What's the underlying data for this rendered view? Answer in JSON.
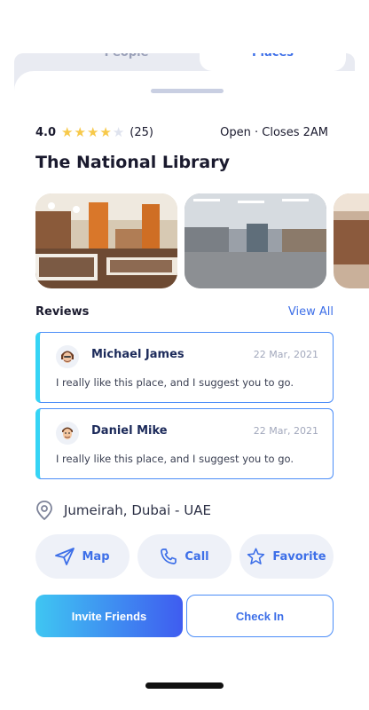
{
  "segment": {
    "tabs": [
      {
        "label": "People"
      },
      {
        "label": "Places"
      }
    ],
    "active": "Places"
  },
  "place": {
    "rating": "4.0",
    "stars": 4,
    "max_stars": 5,
    "review_count": "(25)",
    "hours": "Open · Closes 2AM",
    "name": "The National Library"
  },
  "reviews_section": {
    "label": "Reviews",
    "view_all": "View All",
    "items": [
      {
        "name": "Michael James",
        "date": "22 Mar, 2021",
        "text": "I really like this place, and I suggest you to go."
      },
      {
        "name": "Daniel Mike",
        "date": "22 Mar, 2021",
        "text": "I really like this place, and I suggest you to go."
      }
    ]
  },
  "location": {
    "icon": "location-pin-icon",
    "text": "Jumeirah, Dubai - UAE"
  },
  "actions": [
    {
      "label": "Map",
      "icon": "send-arrow-icon"
    },
    {
      "label": "Call",
      "icon": "phone-icon"
    },
    {
      "label": "Favorite",
      "icon": "star-icon"
    }
  ],
  "buttons": {
    "primary": "Invite Friends",
    "secondary": "Check In"
  },
  "colors": {
    "accent": "#3d6fe8",
    "gradient_start": "#3fc6f2",
    "gradient_end": "#3f5cf0",
    "star": "#f7c94a"
  }
}
